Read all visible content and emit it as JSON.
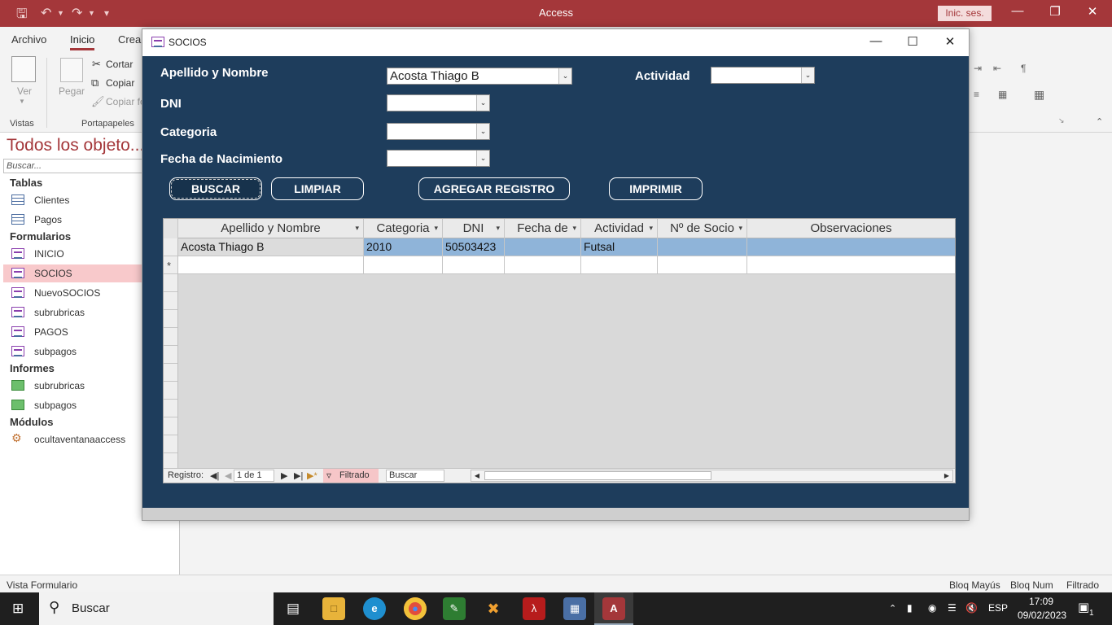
{
  "app": {
    "title": "Access",
    "signin_label": "Inic. ses.",
    "colors": {
      "accent": "#a4373a",
      "form_bg": "#1e3d5c",
      "row_highlight": "#8fb4d9"
    }
  },
  "ribbon": {
    "tabs": [
      "Archivo",
      "Inicio",
      "Crear"
    ],
    "view_label": "Ver",
    "paste_label": "Pegar",
    "cut_label": "Cortar",
    "copy_label": "Copiar",
    "copy_format_label": "Copiar fo",
    "groups": [
      "Vistas",
      "Portapapeles"
    ]
  },
  "nav": {
    "header": "Todos los objeto...",
    "search_placeholder": "Buscar...",
    "categories": {
      "tables": "Tablas",
      "forms": "Formularios",
      "reports": "Informes",
      "modules": "Módulos"
    },
    "tables": [
      "Clientes",
      "Pagos"
    ],
    "forms": [
      "INICIO",
      "SOCIOS",
      "NuevoSOCIOS",
      "subrubricas",
      "PAGOS",
      "subpagos"
    ],
    "reports": [
      "subrubricas",
      "subpagos"
    ],
    "modules": [
      "ocultaventanaaccess"
    ]
  },
  "form": {
    "window_title": "SOCIOS",
    "labels": {
      "name": "Apellido y Nombre",
      "activity": "Actividad",
      "dni": "DNI",
      "category": "Categoria",
      "birth": "Fecha de Nacimiento"
    },
    "values": {
      "name": "Acosta  Thiago B",
      "activity": "",
      "dni": "",
      "category": "",
      "birth": ""
    },
    "buttons": {
      "search": "BUSCAR",
      "clear": "LIMPIAR",
      "add": "AGREGAR REGISTRO",
      "print": "IMPRIMIR"
    }
  },
  "datasheet": {
    "columns": [
      "Apellido y Nombre",
      "Categoria",
      "DNI",
      "Fecha de",
      "Actividad",
      "Nº de Socio",
      "Observaciones"
    ],
    "rows": [
      [
        "Acosta  Thiago B",
        "2010",
        "50503423",
        "",
        "Futsal",
        "",
        ""
      ]
    ],
    "new_row_marker": "*",
    "navigation": {
      "record_label": "Registro:",
      "record_value": "1 de 1",
      "filter_label": "Filtrado",
      "search_label": "Buscar"
    }
  },
  "statusbar": {
    "left": "Vista Formulario",
    "caps": "Bloq Mayús",
    "num": "Bloq Num",
    "filter": "Filtrado"
  },
  "taskbar": {
    "search_label": "Buscar",
    "language": "ESP",
    "time": "17:09",
    "date": "09/02/2023",
    "notifications": "1"
  }
}
